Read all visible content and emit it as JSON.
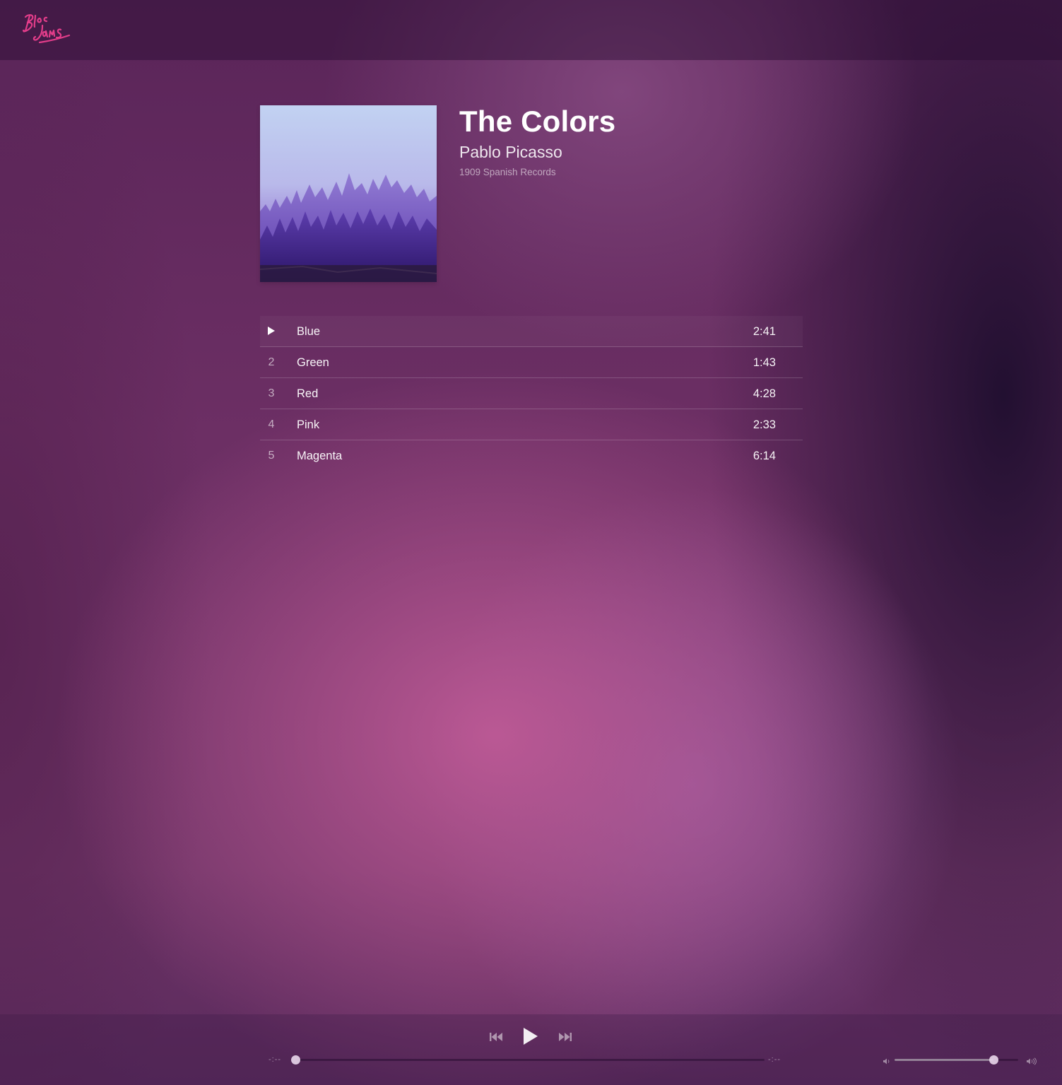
{
  "nav": {
    "logo_text": "Bloc Jams",
    "logo_color": "#e33d8a"
  },
  "album": {
    "title": "The Colors",
    "artist": "Pablo Picasso",
    "release_info": "1909 Spanish Records",
    "cover_icon": "misty-forest-cover"
  },
  "songs": [
    {
      "number": "1",
      "title": "Blue",
      "duration": "2:41",
      "active": true,
      "icon": "play-icon"
    },
    {
      "number": "2",
      "title": "Green",
      "duration": "1:43"
    },
    {
      "number": "3",
      "title": "Red",
      "duration": "4:28"
    },
    {
      "number": "4",
      "title": "Pink",
      "duration": "2:33"
    },
    {
      "number": "5",
      "title": "Magenta",
      "duration": "6:14"
    }
  ],
  "player": {
    "current_time": "-:--",
    "total_time": "-:--",
    "seek_progress": 0,
    "volume_level": 0.8,
    "icons": [
      "previous-icon",
      "play-icon",
      "next-icon",
      "volume-low-icon",
      "volume-high-icon"
    ]
  }
}
